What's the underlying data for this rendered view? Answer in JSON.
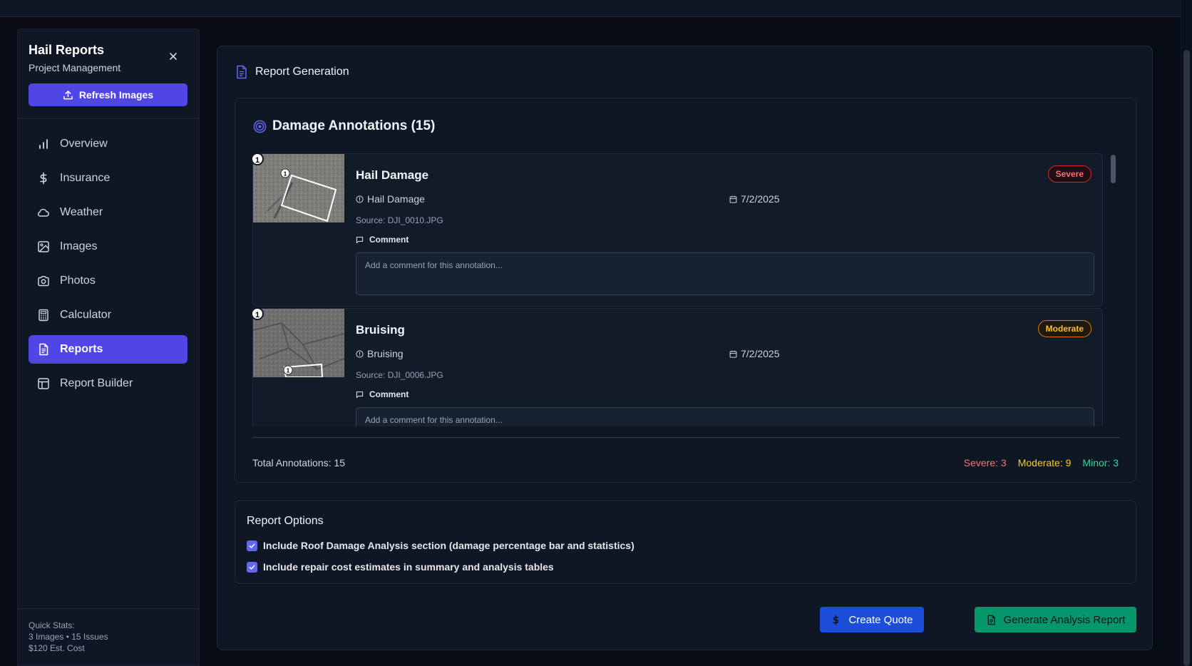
{
  "sidebar": {
    "title": "Hail Reports",
    "subtitle": "Project Management",
    "refresh_label": "Refresh Images",
    "items": [
      {
        "label": "Overview",
        "icon": "bar-chart-icon"
      },
      {
        "label": "Insurance",
        "icon": "dollar-icon"
      },
      {
        "label": "Weather",
        "icon": "cloud-icon"
      },
      {
        "label": "Images",
        "icon": "image-icon"
      },
      {
        "label": "Photos",
        "icon": "camera-icon"
      },
      {
        "label": "Calculator",
        "icon": "calculator-icon"
      },
      {
        "label": "Reports",
        "icon": "file-text-icon",
        "active": true
      },
      {
        "label": "Report Builder",
        "icon": "layout-icon"
      }
    ],
    "quick_stats": {
      "label": "Quick Stats:",
      "line1": "3 Images • 15 Issues",
      "line2": "$120 Est. Cost"
    }
  },
  "main": {
    "header": "Report Generation",
    "annotations": {
      "title": "Damage Annotations (15)",
      "items": [
        {
          "number": "1",
          "name": "Hail Damage",
          "severity": "Severe",
          "type": "Hail Damage",
          "date": "7/2/2025",
          "source": "Source: DJI_0010.JPG",
          "comment_label": "Comment",
          "comment_placeholder": "Add a comment for this annotation..."
        },
        {
          "number": "1",
          "name": "Bruising",
          "severity": "Moderate",
          "type": "Bruising",
          "date": "7/2/2025",
          "source": "Source: DJI_0006.JPG",
          "comment_label": "Comment",
          "comment_placeholder": "Add a comment for this annotation..."
        }
      ],
      "total": "Total Annotations: 15",
      "severe": "Severe: 3",
      "moderate": "Moderate: 9",
      "minor": "Minor: 3"
    },
    "options": {
      "title": "Report Options",
      "opt1": "Include Roof Damage Analysis section (damage percentage bar and statistics)",
      "opt2": "Include repair cost estimates in summary and analysis tables"
    },
    "buttons": {
      "quote": "Create Quote",
      "report": "Generate Analysis Report"
    }
  },
  "colors": {
    "accent": "#4f46e5",
    "severe": "#f87171",
    "moderate": "#facc15",
    "minor": "#34d399",
    "quote_button": "#1d4ed8",
    "report_button": "#059669"
  }
}
